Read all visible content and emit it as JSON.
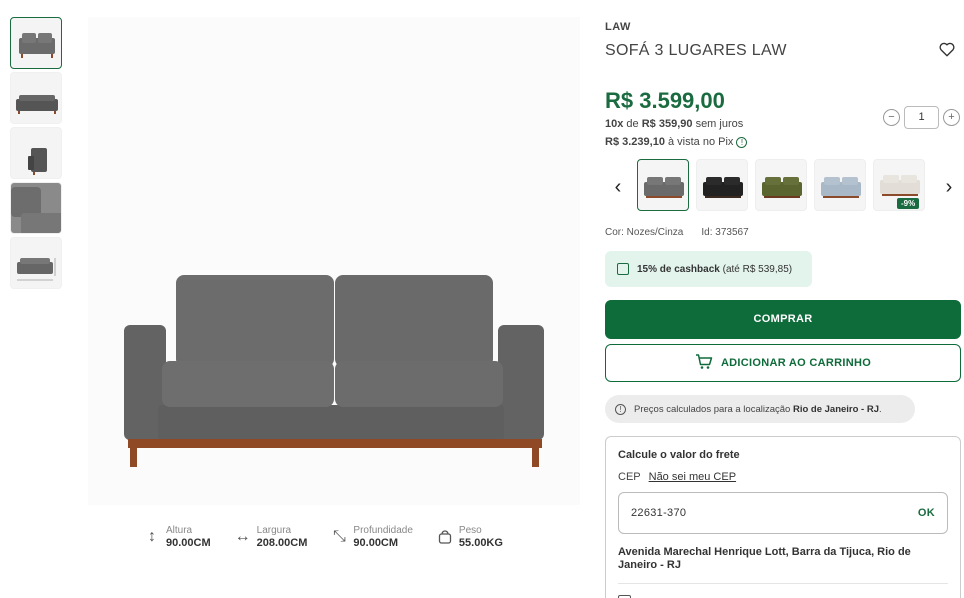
{
  "gallery": {
    "thumbnails": [
      "front-view",
      "front-view-alt",
      "side-view",
      "detail-view",
      "dimensions-view"
    ]
  },
  "dimensions": [
    {
      "label": "Altura",
      "value": "90.00CM",
      "icon": "height-arrow-icon"
    },
    {
      "label": "Largura",
      "value": "208.00CM",
      "icon": "width-arrow-icon"
    },
    {
      "label": "Profundidade",
      "value": "90.00CM",
      "icon": "depth-arrow-icon"
    },
    {
      "label": "Peso",
      "value": "55.00KG",
      "icon": "weight-icon"
    }
  ],
  "product": {
    "brand": "LAW",
    "title": "SOFÁ 3 LUGARES LAW",
    "price": "R$ 3.599,00",
    "installments_count": "10x",
    "installments_de": "de",
    "installments_value": "R$ 359,90",
    "installments_suffix": "sem juros",
    "pix_value": "R$ 3.239,10",
    "pix_suffix": "à vista no Pix",
    "color_label": "Cor: Nozes/Cinza",
    "id_label": "Id: 373567"
  },
  "quantity": {
    "minus": "−",
    "value": "1",
    "plus": "+"
  },
  "swatches": [
    {
      "name": "cinza",
      "color": "#6a6a6a"
    },
    {
      "name": "preto",
      "color": "#222222"
    },
    {
      "name": "verde",
      "color": "#5a6530"
    },
    {
      "name": "azul",
      "color": "#a9b8c6"
    },
    {
      "name": "bege",
      "color": "#e2ddd6",
      "badge": "-9%"
    }
  ],
  "cashback": {
    "highlight": "15% de cashback",
    "detail": "(até R$ 539,85)"
  },
  "buttons": {
    "buy": "COMPRAR",
    "cart": "ADICIONAR AO CARRINHO"
  },
  "location": {
    "text": "Preços calculados para a localização",
    "place": "Rio de Janeiro - RJ",
    "end": "."
  },
  "shipping": {
    "title": "Calcule o valor do frete",
    "cep_label": "CEP",
    "cep_link": "Não sei meu CEP",
    "cep_value": "22631-370",
    "ok": "OK",
    "address": "Avenida Marechal Henrique Lott, Barra da Tijuca, Rio de Janeiro - RJ"
  },
  "colors": {
    "brand_green": "#1a6b3f",
    "cashback_bg": "#e3f4ec"
  }
}
